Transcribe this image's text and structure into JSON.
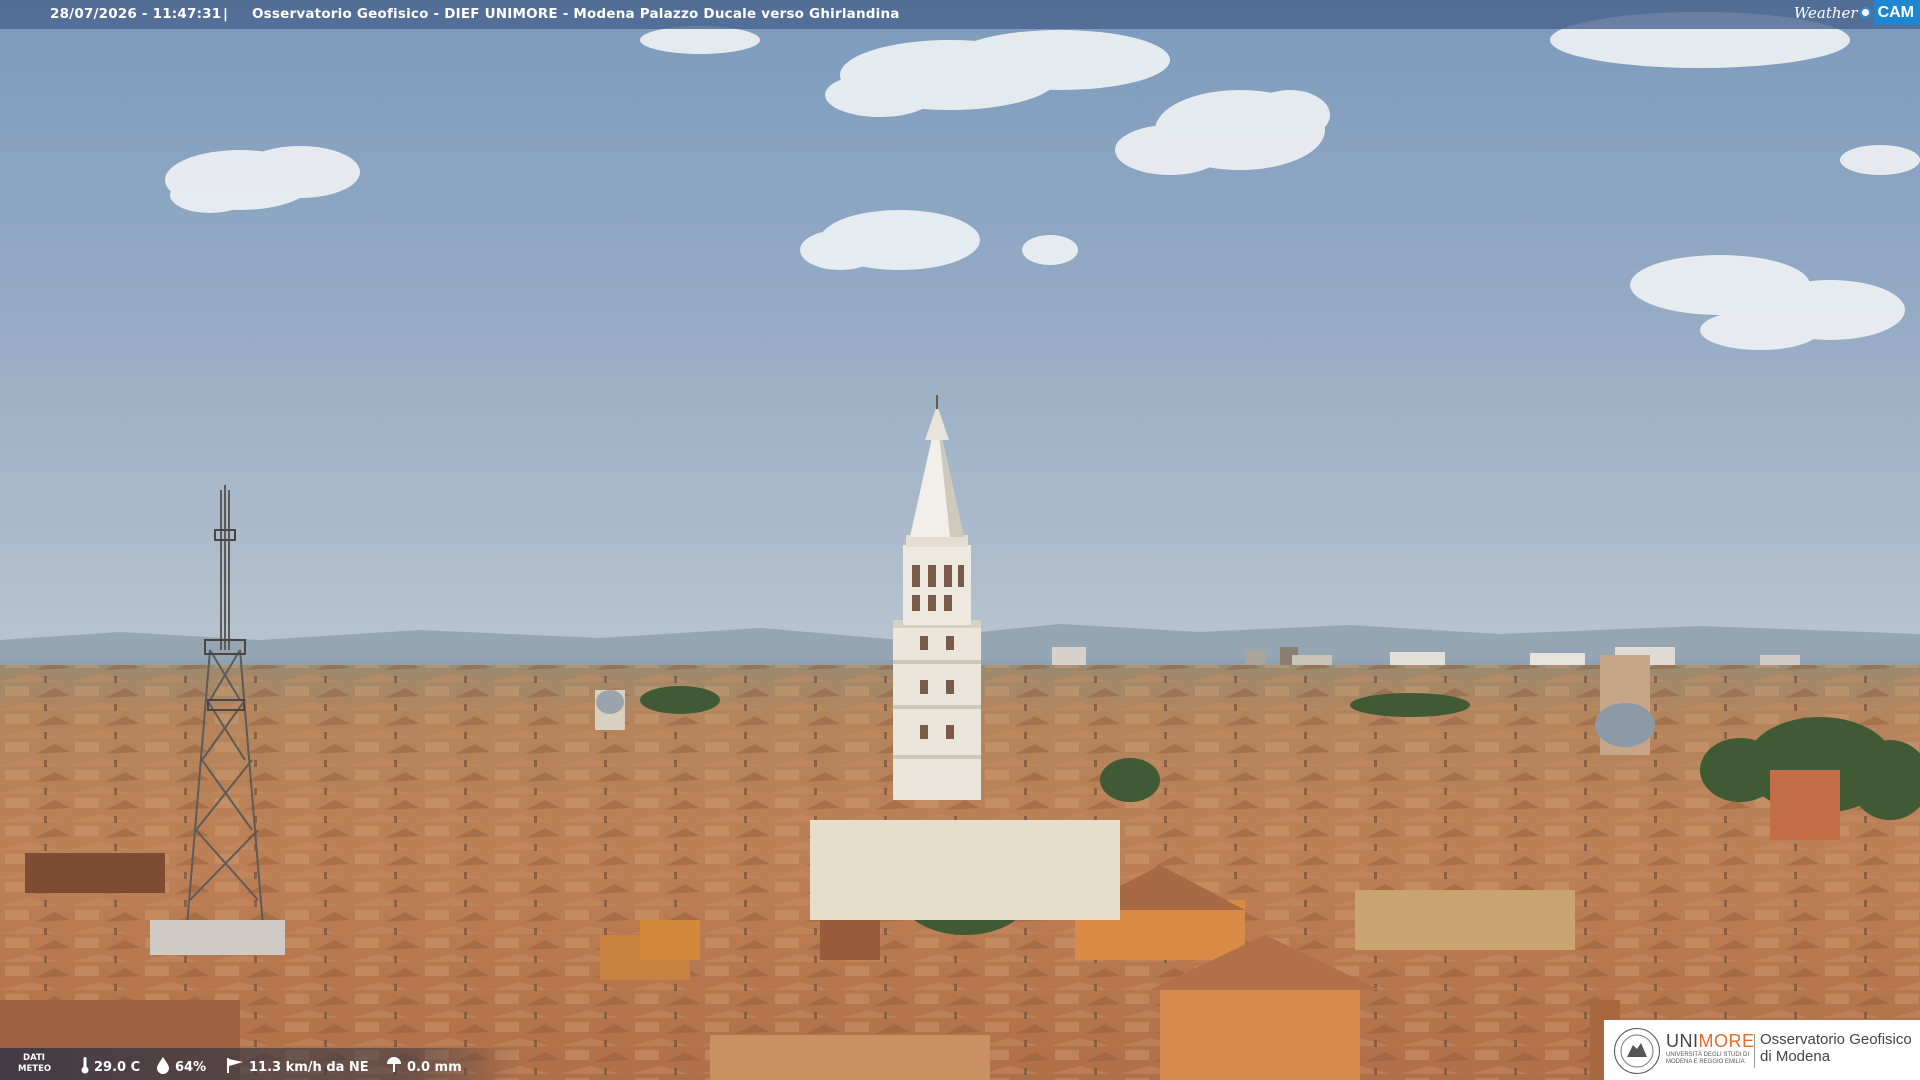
{
  "header": {
    "datetime": "28/07/2026 - 11:47:31",
    "separator": "|",
    "title": "Osservatorio Geofisico - DIEF UNIMORE - Modena Palazzo Ducale verso Ghirlandina"
  },
  "brand": {
    "weather_text": "Weather",
    "cam_text": "CAM",
    "accent_color": "#1f86d1"
  },
  "weather": {
    "label_line1": "DATI",
    "label_line2": "METEO",
    "temperature": "29.0 C",
    "humidity": "64%",
    "wind": "11.3 km/h da NE",
    "rain": "0.0 mm",
    "icons": [
      "thermometer-icon",
      "humidity-drop-icon",
      "wind-flag-icon",
      "rain-gauge-icon"
    ]
  },
  "logo": {
    "uni": "UNI",
    "more": "MORE",
    "sub_line1": "UNIVERSITÀ DEGLI STUDI DI",
    "sub_line2": "MODENA E REGGIO EMILIA",
    "org_line1": "Osservatorio Geofisico",
    "org_line2": "di Modena",
    "accent_color": "#e46c2a"
  }
}
